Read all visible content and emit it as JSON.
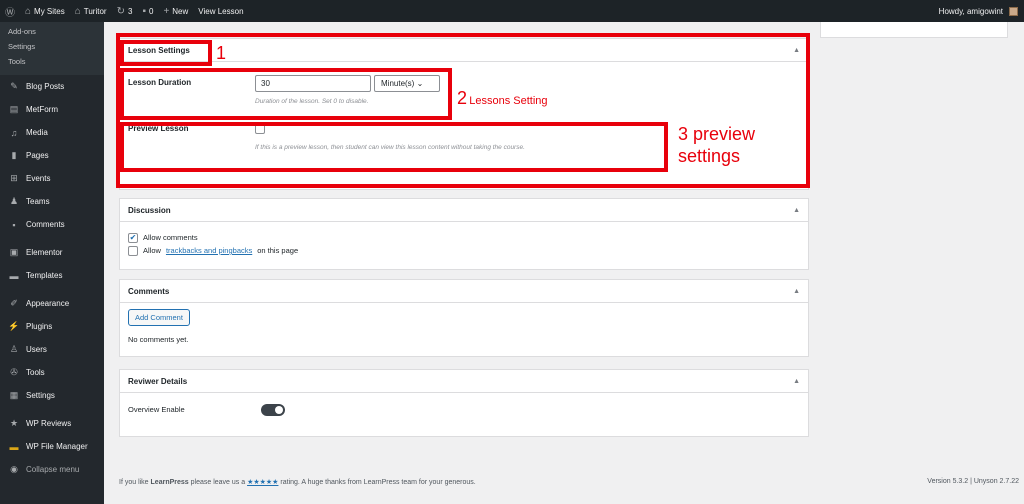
{
  "adminbar": {
    "my_sites": "My Sites",
    "site_name": "Turitor",
    "updates_count": "3",
    "comments_count": "0",
    "new_label": "New",
    "view_label": "View Lesson",
    "howdy": "Howdy, amigowint"
  },
  "sidebar": {
    "top_subitems": [
      "Add-ons",
      "Settings",
      "Tools"
    ],
    "items": [
      {
        "label": "Blog Posts",
        "icon": "pin-icon"
      },
      {
        "label": "MetForm",
        "icon": "form-icon"
      },
      {
        "label": "Media",
        "icon": "media-icon"
      },
      {
        "label": "Pages",
        "icon": "pages-icon"
      },
      {
        "label": "Events",
        "icon": "events-icon"
      },
      {
        "label": "Teams",
        "icon": "teams-icon"
      },
      {
        "label": "Comments",
        "icon": "comments-icon"
      },
      {
        "label": "Elementor",
        "icon": "elementor-icon"
      },
      {
        "label": "Templates",
        "icon": "folder-icon"
      },
      {
        "label": "Appearance",
        "icon": "brush-icon"
      },
      {
        "label": "Plugins",
        "icon": "plugin-icon"
      },
      {
        "label": "Users",
        "icon": "user-icon"
      },
      {
        "label": "Tools",
        "icon": "wrench-icon"
      },
      {
        "label": "Settings",
        "icon": "settings-icon"
      },
      {
        "label": "WP Reviews",
        "icon": "star-icon"
      },
      {
        "label": "WP File Manager",
        "icon": "folder-icon"
      },
      {
        "label": "Collapse menu",
        "icon": "collapse-icon"
      }
    ]
  },
  "lesson_settings": {
    "title": "Lesson Settings",
    "duration_label": "Lesson Duration",
    "duration_value": "30",
    "duration_unit": "Minute(s)",
    "duration_hint": "Duration of the lesson. Set 0 to disable.",
    "preview_label": "Preview Lesson",
    "preview_hint": "If this is a preview lesson, then student can view this lesson content without taking the course."
  },
  "discussion": {
    "title": "Discussion",
    "allow_comments": "Allow comments",
    "allow_prefix": "Allow",
    "trackbacks_link": "trackbacks and pingbacks",
    "allow_suffix": "on this page"
  },
  "comments": {
    "title": "Comments",
    "add_button": "Add Comment",
    "empty": "No comments yet."
  },
  "reviewer": {
    "title": "Reviwer Details",
    "overview_label": "Overview Enable"
  },
  "footer": {
    "prefix": "If you like",
    "brand": "LearnPress",
    "middle": "please leave us a",
    "stars": "★★★★★",
    "suffix": "rating. A huge thanks from LearnPress team for your generous.",
    "version": "Version 5.3.2 | Unyson 2.7.22"
  },
  "annotations": {
    "label1": "1",
    "label2_num": "2",
    "label2_text": "Lessons Setting",
    "label3_line1": "3 preview",
    "label3_line2": "settings"
  }
}
